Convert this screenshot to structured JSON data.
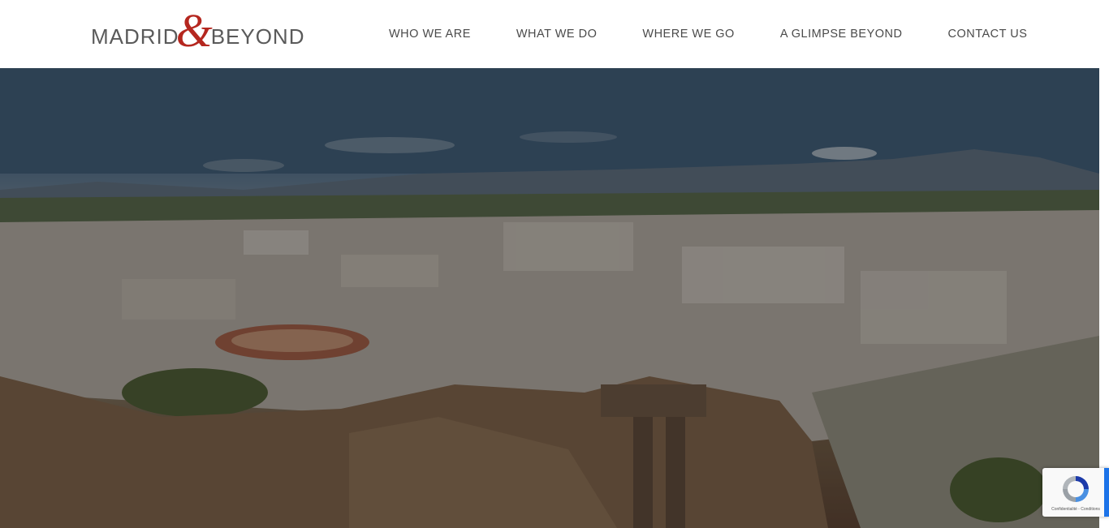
{
  "header": {
    "logo": {
      "left": "MADRID",
      "amp": "&",
      "right": "BEYOND"
    },
    "nav": [
      {
        "label": "WHO WE ARE"
      },
      {
        "label": "WHAT WE DO"
      },
      {
        "label": "WHERE WE GO"
      },
      {
        "label": "A GLIMPSE BEYOND"
      },
      {
        "label": "CONTACT US"
      }
    ]
  },
  "recaptcha": {
    "privacy": "Confidentialité",
    "separator": " - ",
    "terms": "Conditions"
  },
  "colors": {
    "brand_red": "#b5271f",
    "nav_text": "#4a4a4a",
    "recaptcha_blue": "#1c73e8"
  }
}
